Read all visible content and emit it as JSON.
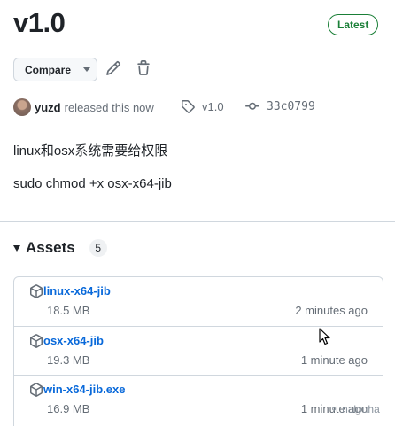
{
  "release": {
    "title": "v1.0",
    "badge": "Latest"
  },
  "toolbar": {
    "compare_label": "Compare",
    "edit_icon": "pencil-icon",
    "delete_icon": "trash-icon"
  },
  "meta": {
    "author": "yuzd",
    "action": "released this now",
    "tag": "v1.0",
    "commit": "33c0799"
  },
  "body": {
    "line1": "linux和osx系统需要给权限",
    "line2": "sudo chmod +x osx-x64-jib"
  },
  "assets": {
    "title": "Assets",
    "count": "5",
    "items": [
      {
        "name": "linux-x64-jib",
        "size": "18.5 MB",
        "time": "2 minutes ago"
      },
      {
        "name": "osx-x64-jib",
        "size": "19.3 MB",
        "time": "1 minute ago"
      },
      {
        "name": "win-x64-jib.exe",
        "size": "16.9 MB",
        "time": "1 minute ago"
      }
    ]
  },
  "watermark": {
    "text": "nalouha"
  },
  "colors": {
    "accent_link": "#0969da",
    "latest_green": "#1a7f37",
    "muted": "#656d76",
    "border": "#d0d7de"
  }
}
